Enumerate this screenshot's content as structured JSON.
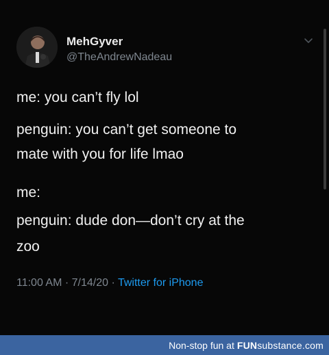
{
  "tweet": {
    "display_name": "MehGyver",
    "handle": "@TheAndrewNadeau",
    "lines": [
      "me: you can’t fly lol",
      "penguin: you can’t get someone to",
      "mate with you for life lmao",
      "me:",
      "penguin: dude don—don’t cry at the",
      "zoo"
    ],
    "time": "11:00 AM",
    "date": "7/14/20",
    "separator": " · ",
    "client": "Twitter for iPhone",
    "menu_icon": "chevron-down-icon",
    "avatar_icon": "avatar"
  },
  "footer": {
    "text": "Non-stop fun at",
    "brand_bold": "FUN",
    "brand_rest": "substance",
    "brand_tld": ".com"
  },
  "colors": {
    "background": "#050505",
    "text": "#f0f0f0",
    "muted": "#7f8790",
    "link": "#1d9bf0",
    "footer": "#3b64a0"
  }
}
